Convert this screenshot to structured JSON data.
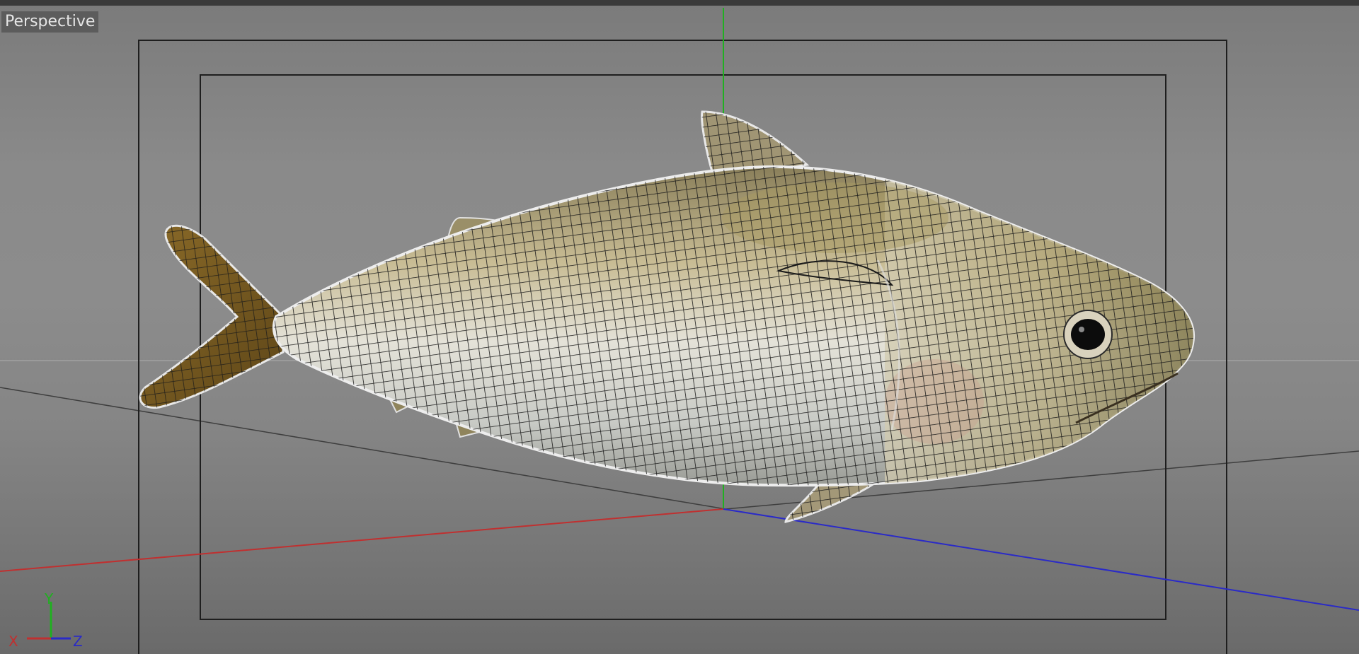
{
  "viewport": {
    "camera_label": "Perspective",
    "axis_labels": {
      "x": "X",
      "y": "Y",
      "z": "Z"
    },
    "colors": {
      "background": "#8a8a8a",
      "x_axis": "#c03030",
      "y_axis": "#20b020",
      "z_axis": "#2a2ac8",
      "safe_frame": "#1e1e1e"
    },
    "object": {
      "name": "fish-model",
      "display": "textured with wireframe overlay"
    }
  }
}
